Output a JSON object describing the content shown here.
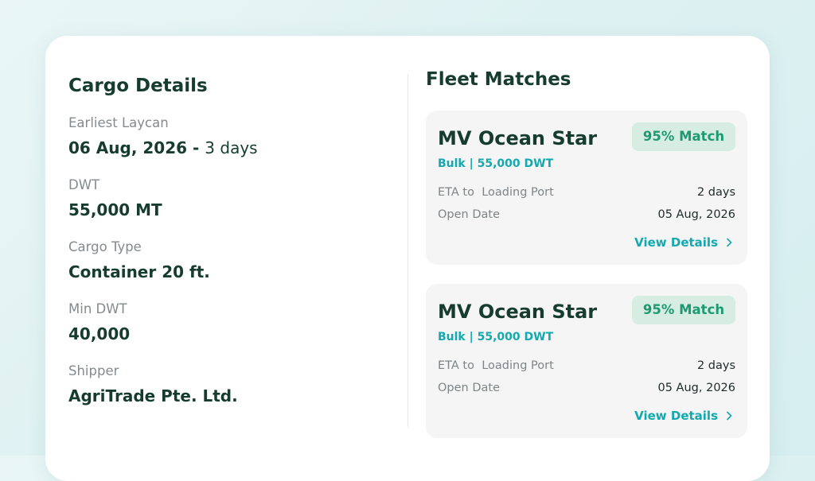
{
  "cargo_details": {
    "title": "Cargo Details",
    "fields": [
      {
        "label": "Earliest Laycan",
        "value": "06 Aug, 2026",
        "separator": " - ",
        "suffix": "3 days"
      },
      {
        "label": "DWT",
        "value": "55,000 MT"
      },
      {
        "label": "Cargo Type",
        "value": "Container 20 ft."
      },
      {
        "label": "Min DWT",
        "value": "40,000"
      },
      {
        "label": "Shipper",
        "value": "AgriTrade Pte. Ltd."
      }
    ]
  },
  "fleet_matches": {
    "title": "Fleet Matches",
    "vessels": [
      {
        "name": "MV Ocean Star",
        "match": "95% Match",
        "subtitle": "Bulk | 55,000 DWT",
        "eta_label": "ETA to  Loading Port",
        "eta_value": "2 days",
        "open_label": "Open Date",
        "open_value": "05 Aug, 2026",
        "view_label": "View Details"
      },
      {
        "name": "MV Ocean Star",
        "match": "95% Match",
        "subtitle": "Bulk | 55,000 DWT",
        "eta_label": "ETA to  Loading Port",
        "eta_value": "2 days",
        "open_label": "Open Date",
        "open_value": "05 Aug, 2026",
        "view_label": "View Details"
      }
    ]
  },
  "icons": {
    "view_details": "chevron-right-icon"
  },
  "colors": {
    "heading": "#163c2f",
    "accent_teal": "#14a9ae",
    "match_green": "#1e9a72",
    "match_bg": "#d7ede3",
    "card_bg": "#f5f5f5",
    "label_gray": "#858a8d"
  }
}
